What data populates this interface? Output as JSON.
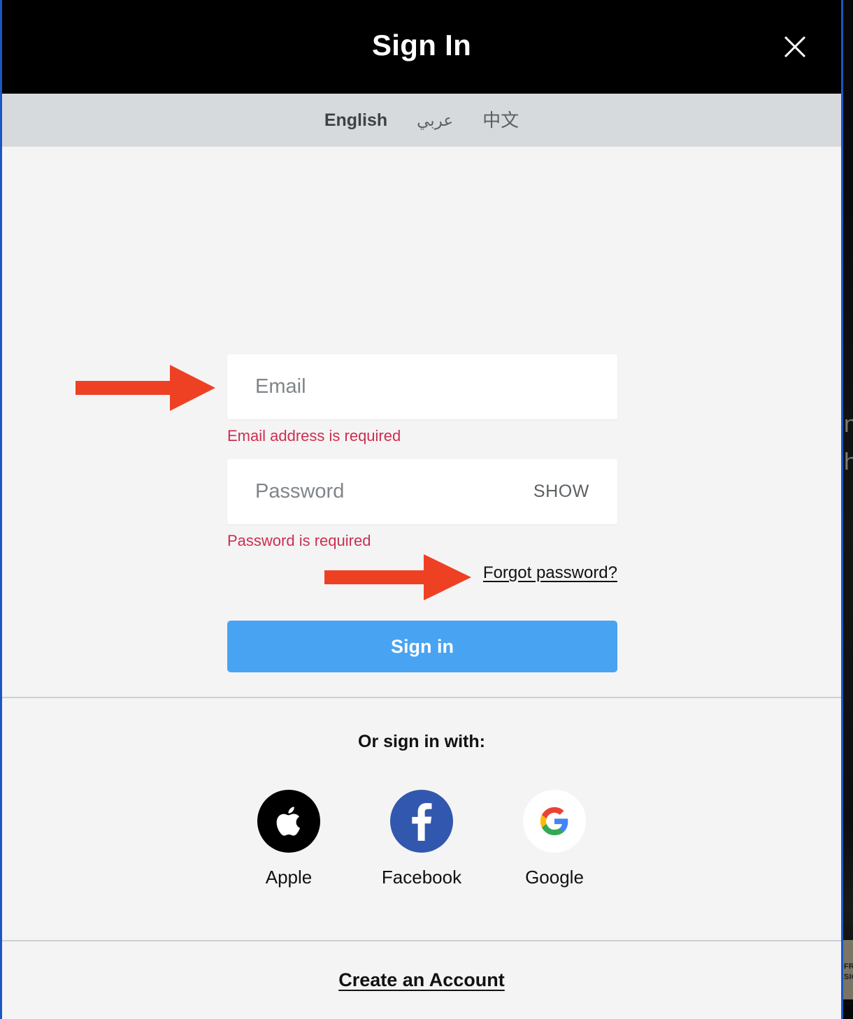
{
  "header": {
    "title": "Sign In",
    "close_icon": "close-icon"
  },
  "language_bar": {
    "languages": [
      {
        "label": "English",
        "active": true
      },
      {
        "label": "عربي",
        "active": false
      },
      {
        "label": "中文",
        "active": false
      }
    ]
  },
  "form": {
    "email": {
      "placeholder": "Email",
      "value": "",
      "error": "Email address is required"
    },
    "password": {
      "placeholder": "Password",
      "value": "",
      "error": "Password is required",
      "show_label": "SHOW"
    },
    "forgot_password_label": "Forgot password?",
    "signin_button_label": "Sign in"
  },
  "social": {
    "heading": "Or sign in with:",
    "providers": [
      {
        "label": "Apple",
        "icon": "apple-icon"
      },
      {
        "label": "Facebook",
        "icon": "facebook-icon"
      },
      {
        "label": "Google",
        "icon": "google-icon"
      }
    ]
  },
  "footer": {
    "create_account_label": "Create an Account"
  },
  "background": {
    "ghost_text_1": "n",
    "ghost_text_2": "h",
    "ghost_small_1": "FRE",
    "ghost_small_2": "SIG"
  },
  "colors": {
    "header_background": "#000000",
    "language_bar_background": "#d7dadc",
    "body_background": "#f4f4f4",
    "accent_blue": "#49a3f3",
    "modal_border": "#1a56c4",
    "error_red": "#cc2f50",
    "annotation_arrow": "#ee4123",
    "apple_black": "#000000",
    "facebook_blue": "#3257ae",
    "google_white": "#ffffff"
  }
}
